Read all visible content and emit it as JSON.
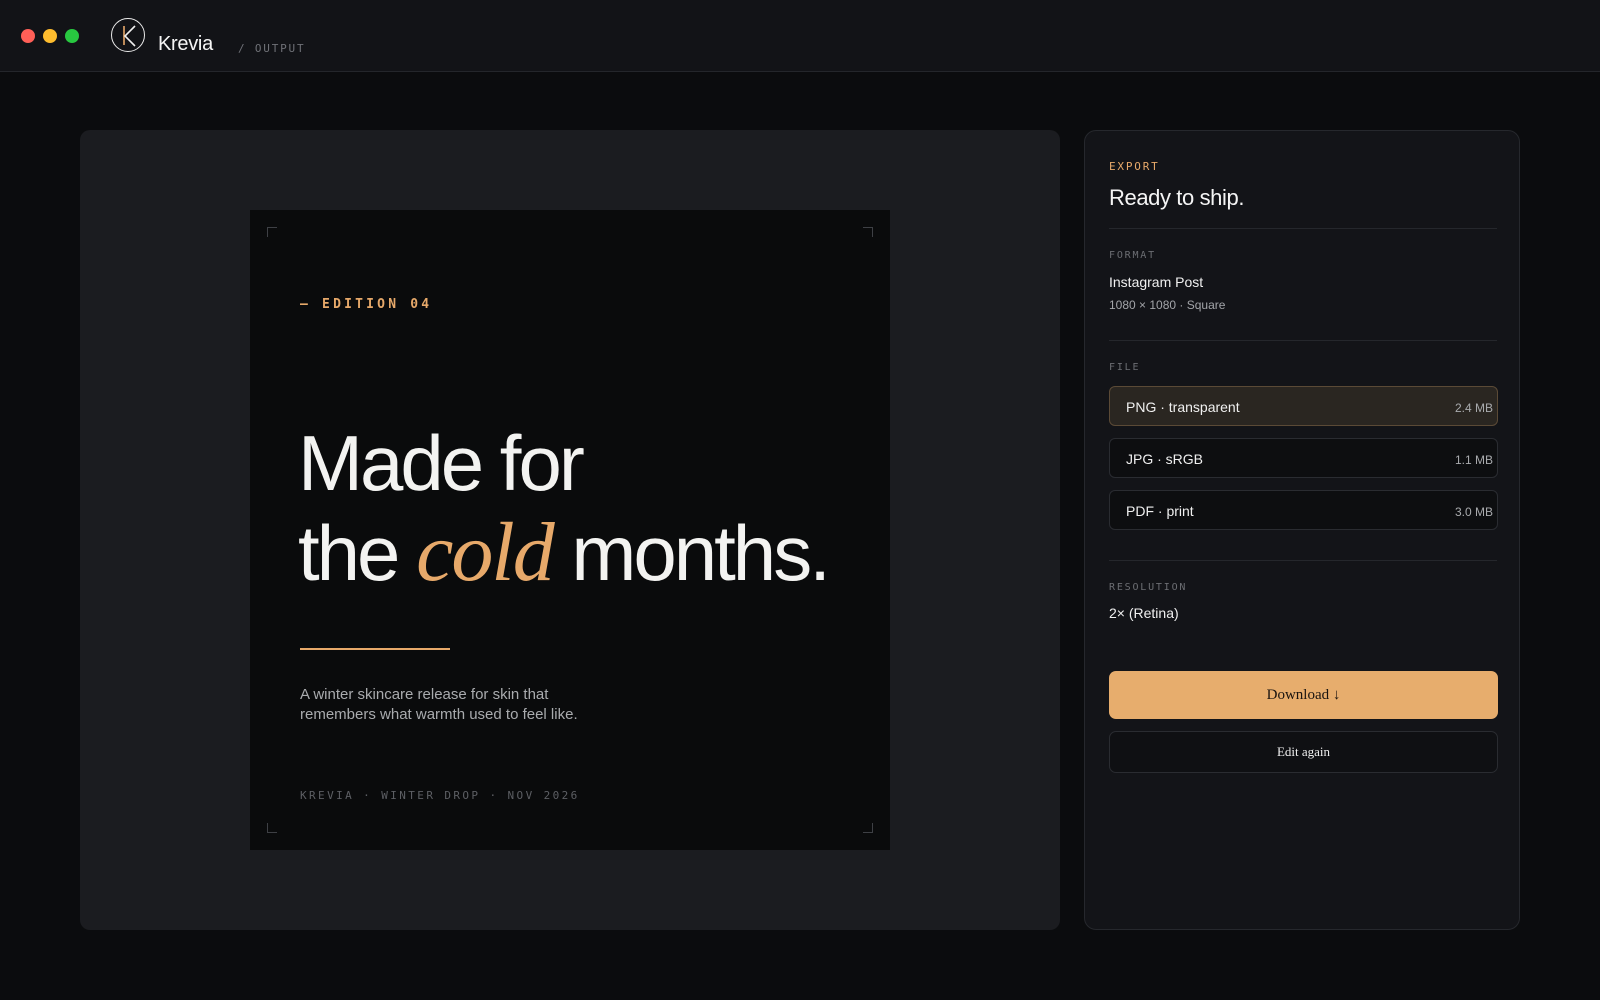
{
  "app": {
    "name": "Krevia",
    "breadcrumb": "/ OUTPUT",
    "logo_letter": "K"
  },
  "artboard": {
    "edition": "— EDITION 04",
    "headline_line1": "Made for",
    "headline_the": "the",
    "headline_accent": "cold",
    "headline_end": "months.",
    "body": "A winter skincare release for skin that remembers what warmth used to feel like.",
    "footer": "KREVIA · WINTER DROP · NOV 2026"
  },
  "export": {
    "kicker": "EXPORT",
    "title": "Ready to ship.",
    "format_label": "FORMAT",
    "format_name": "Instagram Post",
    "format_size": "1080 × 1080 · Square",
    "file_label": "FILE",
    "files": [
      {
        "name": "PNG · transparent",
        "size": "2.4 MB",
        "selected": true
      },
      {
        "name": "JPG · sRGB",
        "size": "1.1 MB",
        "selected": false
      },
      {
        "name": "PDF · print",
        "size": "3.0 MB",
        "selected": false
      }
    ],
    "resolution_label": "RESOLUTION",
    "resolution_value": "2× (Retina)",
    "download_label": "Download ↓",
    "edit_label": "Edit again"
  },
  "colors": {
    "accent": "#e7a96a",
    "background": "#0b0c0e",
    "panel": "#131418"
  }
}
